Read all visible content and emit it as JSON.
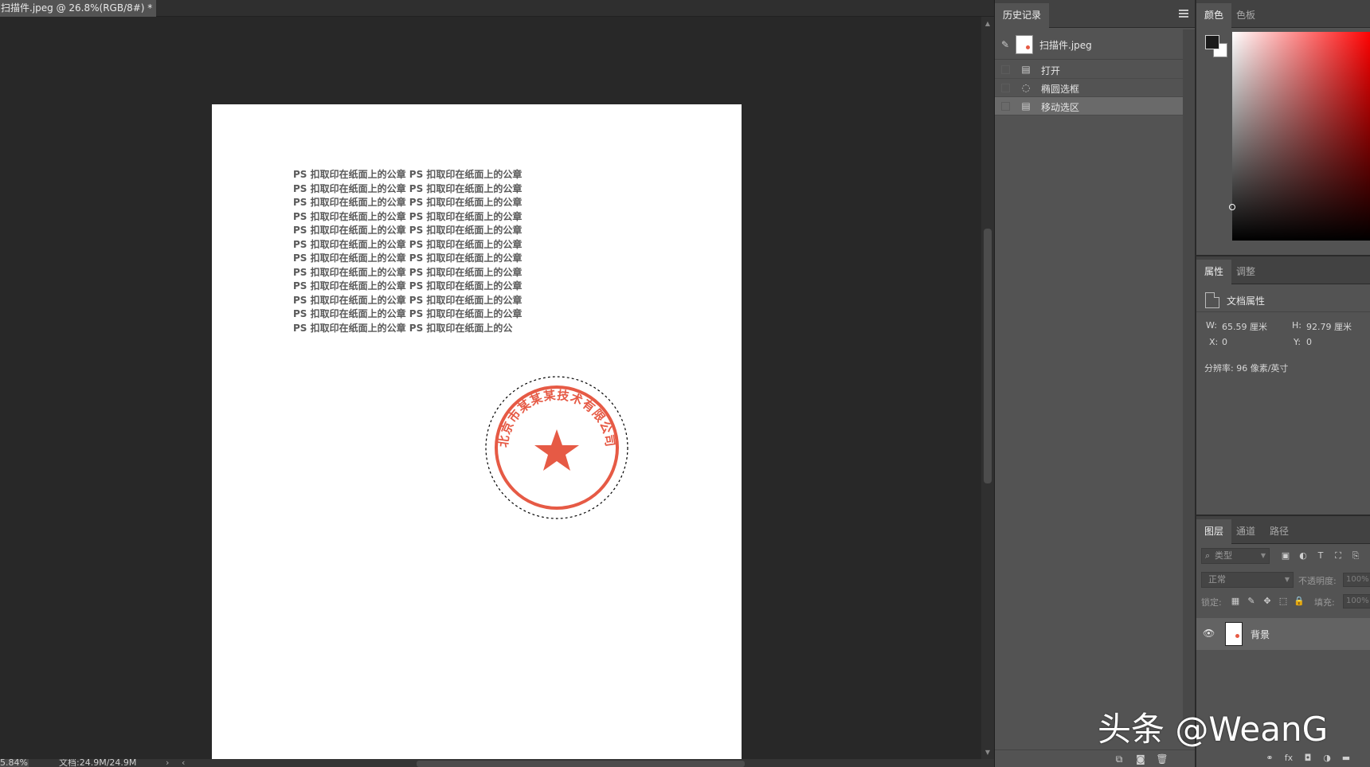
{
  "document": {
    "tab_title": "扫描件.jpeg @ 26.8%(RGB/8#) *",
    "tab_close": "×",
    "paper_lines": [
      "PS 扣取印在纸面上的公章 PS 扣取印在纸面上的公章",
      "PS 扣取印在纸面上的公章 PS 扣取印在纸面上的公章",
      "PS 扣取印在纸面上的公章 PS 扣取印在纸面上的公章",
      "PS 扣取印在纸面上的公章 PS 扣取印在纸面上的公章",
      "PS 扣取印在纸面上的公章 PS 扣取印在纸面上的公章",
      "PS 扣取印在纸面上的公章 PS 扣取印在纸面上的公章",
      "PS 扣取印在纸面上的公章 PS 扣取印在纸面上的公章",
      "PS 扣取印在纸面上的公章 PS 扣取印在纸面上的公章",
      "PS 扣取印在纸面上的公章 PS 扣取印在纸面上的公章",
      "PS 扣取印在纸面上的公章 PS 扣取印在纸面上的公章",
      "PS 扣取印在纸面上的公章 PS 扣取印在纸面上的公章",
      "PS 扣取印在纸面上的公章 PS 扣取印在纸面上的公"
    ],
    "stamp_text": "北京市某某某技术有限公司",
    "stamp_color": "#e65a45"
  },
  "status": {
    "zoom": "5.84%",
    "doc_info": "文档:24.9M/24.9M",
    "nav_right": "›",
    "nav_left": "‹"
  },
  "history": {
    "tab_label": "历史记录",
    "snapshot_label": "扫描件.jpeg",
    "items": [
      {
        "label": "打开",
        "icon": "document-icon"
      },
      {
        "label": "椭圆选框",
        "icon": "ellipse-marquee-icon"
      },
      {
        "label": "移动选区",
        "icon": "document-icon",
        "selected": true
      }
    ]
  },
  "color_panel": {
    "tabs": [
      "颜色",
      "色板"
    ],
    "fg": "#1a1a1a",
    "bg": "#ffffff"
  },
  "properties": {
    "tabs": [
      "属性",
      "调整"
    ],
    "title": "文档属性",
    "w_label": "W:",
    "w_value": "65.59 厘米",
    "h_label": "H:",
    "h_value": "92.79 厘米",
    "x_label": "X:",
    "x_value": "0",
    "y_label": "Y:",
    "y_value": "0",
    "resolution": "分辨率: 96 像素/英寸"
  },
  "layers": {
    "tabs": [
      "图层",
      "通道",
      "路径"
    ],
    "filter_placeholder": "类型",
    "blend_mode": "正常",
    "opacity_label": "不透明度:",
    "opacity_value": "100%",
    "lock_label": "锁定:",
    "fill_label": "填充:",
    "fill_value": "100%",
    "layer_name": "背景"
  },
  "watermark": "头条 @WeanG"
}
